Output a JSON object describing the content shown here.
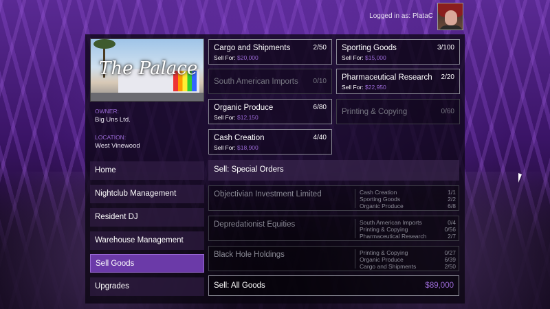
{
  "header": {
    "login_text": "Logged in as: PlataC"
  },
  "business": {
    "logo_text": "The Palace",
    "owner_label": "OWNER:",
    "owner_value": "Big Uns Ltd.",
    "location_label": "LOCATION:",
    "location_value": "West Vinewood"
  },
  "nav": {
    "items": [
      {
        "label": "Home"
      },
      {
        "label": "Nightclub Management"
      },
      {
        "label": "Resident DJ"
      },
      {
        "label": "Warehouse Management"
      },
      {
        "label": "Sell Goods",
        "active": true
      },
      {
        "label": "Upgrades"
      }
    ]
  },
  "goods": [
    {
      "name": "Cargo and Shipments",
      "count": "2/50",
      "sell_label": "Sell For:",
      "amount": "$20,000",
      "enabled": true
    },
    {
      "name": "Sporting Goods",
      "count": "3/100",
      "sell_label": "Sell For:",
      "amount": "$15,000",
      "enabled": true
    },
    {
      "name": "South American Imports",
      "count": "0/10",
      "enabled": false
    },
    {
      "name": "Pharmaceutical Research",
      "count": "2/20",
      "sell_label": "Sell For:",
      "amount": "$22,950",
      "enabled": true
    },
    {
      "name": "Organic Produce",
      "count": "6/80",
      "sell_label": "Sell For:",
      "amount": "$12,150",
      "enabled": true
    },
    {
      "name": "Printing & Copying",
      "count": "0/60",
      "enabled": false
    },
    {
      "name": "Cash Creation",
      "count": "4/40",
      "sell_label": "Sell For:",
      "amount": "$18,900",
      "enabled": true
    }
  ],
  "special_orders": {
    "title": "Sell: Special Orders",
    "orders": [
      {
        "name": "Objectivian Investment Limited",
        "lines": [
          {
            "good": "Cash Creation",
            "count": "1/1"
          },
          {
            "good": "Sporting Goods",
            "count": "2/2"
          },
          {
            "good": "Organic Produce",
            "count": "6/8"
          }
        ]
      },
      {
        "name": "Depredationist Equities",
        "lines": [
          {
            "good": "South American Imports",
            "count": "0/4"
          },
          {
            "good": "Printing & Copying",
            "count": "0/56"
          },
          {
            "good": "Pharmaceutical Research",
            "count": "2/7"
          }
        ]
      },
      {
        "name": "Black Hole Holdings",
        "lines": [
          {
            "good": "Printing & Copying",
            "count": "0/27"
          },
          {
            "good": "Organic Produce",
            "count": "6/39"
          },
          {
            "good": "Cargo and Shipments",
            "count": "2/50"
          }
        ]
      }
    ]
  },
  "sell_all": {
    "label": "Sell: All Goods",
    "value": "$89,000"
  },
  "colors": {
    "accent": "#9b6ad6",
    "active_nav": "#6b3aa8"
  }
}
